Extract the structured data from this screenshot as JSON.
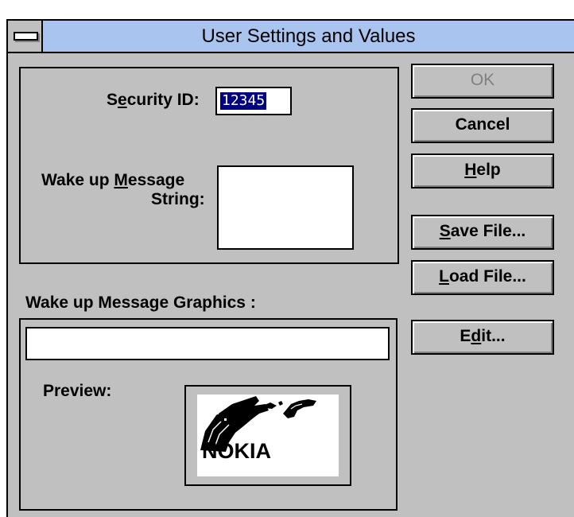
{
  "window": {
    "title": "User Settings and Values"
  },
  "security": {
    "label_pre": "S",
    "label_u": "e",
    "label_post": "curity ID:",
    "value": "12345"
  },
  "wake_string": {
    "label_line1_pre": "Wake up ",
    "label_line1_u": "M",
    "label_line1_post": "essage",
    "label_line2": "String:",
    "value": ""
  },
  "graphics": {
    "label": "Wake up Message Graphics :",
    "file_value": "",
    "preview_label": "Preview:",
    "preview_image": "NOKIA"
  },
  "buttons": {
    "ok": "OK",
    "cancel": "Cancel",
    "help_u": "H",
    "help_rest": "elp",
    "save_u": "S",
    "save_rest": "ave File...",
    "load_u": "L",
    "load_rest": "oad File...",
    "edit_pre": "E",
    "edit_u": "d",
    "edit_post": "it..."
  },
  "colors": {
    "title_bar": "#a9c4ee",
    "face": "#c0c0c0",
    "selection": "#000080"
  }
}
